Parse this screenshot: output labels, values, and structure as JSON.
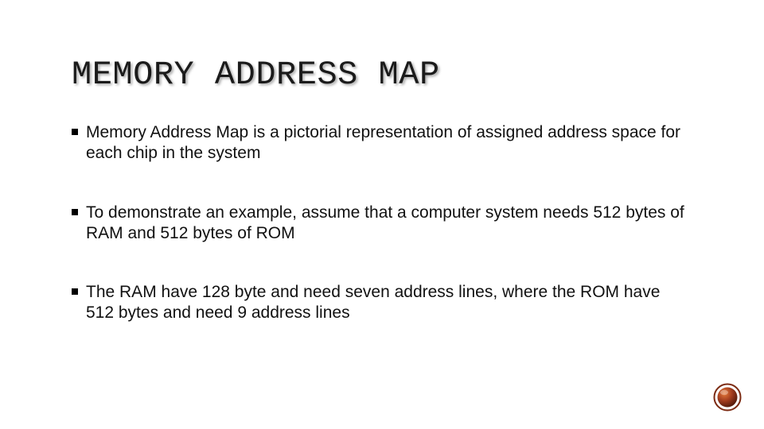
{
  "slide": {
    "title": "MEMORY ADDRESS MAP",
    "bullets": [
      "Memory Address Map is a pictorial representation of assigned address space for each chip in the system",
      "To demonstrate an example, assume that a computer system needs 512 bytes of RAM and 512 bytes of ROM",
      "The RAM have 128 byte and need seven address lines, where the ROM have 512 bytes and need 9 address lines"
    ]
  },
  "theme": {
    "accent": "#a23d1f",
    "text": "#111111",
    "background": "#ffffff"
  }
}
